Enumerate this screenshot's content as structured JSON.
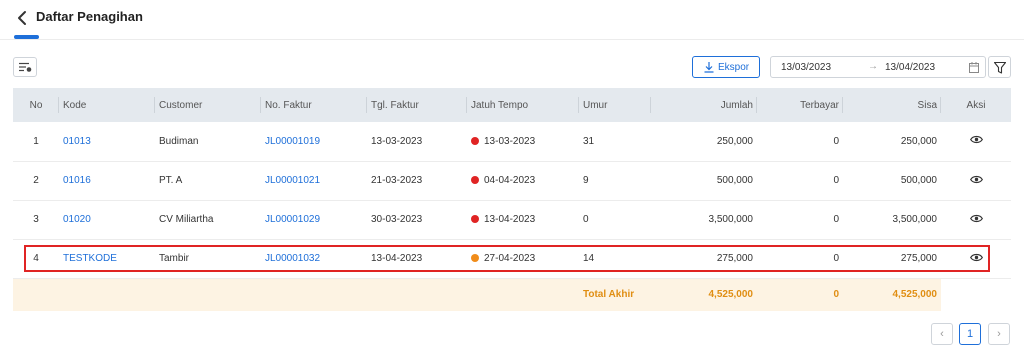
{
  "header": {
    "title": "Daftar Penagihan"
  },
  "toolbar": {
    "export_label": "Ekspor",
    "date_from": "13/03/2023",
    "date_arrow": "→",
    "date_to": "13/04/2023"
  },
  "table": {
    "columns": [
      "No",
      "Kode",
      "Customer",
      "No. Faktur",
      "Tgl. Faktur",
      "Jatuh Tempo",
      "Umur",
      "Jumlah",
      "Terbayar",
      "Sisa",
      "Aksi"
    ],
    "rows": [
      {
        "no": "1",
        "kode": "01013",
        "customer": "Budiman",
        "faktur": "JL00001019",
        "tgl": "13-03-2023",
        "jatuh_tempo": "13-03-2023",
        "status_color": "#e02424",
        "umur": "31",
        "jumlah": "250,000",
        "terbayar": "0",
        "sisa": "250,000"
      },
      {
        "no": "2",
        "kode": "01016",
        "customer": "PT. A",
        "faktur": "JL00001021",
        "tgl": "21-03-2023",
        "jatuh_tempo": "04-04-2023",
        "status_color": "#e02424",
        "umur": "9",
        "jumlah": "500,000",
        "terbayar": "0",
        "sisa": "500,000"
      },
      {
        "no": "3",
        "kode": "01020",
        "customer": "CV Miliartha",
        "faktur": "JL00001029",
        "tgl": "30-03-2023",
        "jatuh_tempo": "13-04-2023",
        "status_color": "#e02424",
        "umur": "0",
        "jumlah": "3,500,000",
        "terbayar": "0",
        "sisa": "3,500,000"
      },
      {
        "no": "4",
        "kode": "TESTKODE",
        "customer": "Tambir",
        "faktur": "JL00001032",
        "tgl": "13-04-2023",
        "jatuh_tempo": "27-04-2023",
        "status_color": "#f08c1a",
        "umur": "14",
        "jumlah": "275,000",
        "terbayar": "0",
        "sisa": "275,000"
      }
    ],
    "total": {
      "label": "Total Akhir",
      "jumlah": "4,525,000",
      "terbayar": "0",
      "sisa": "4,525,000"
    }
  },
  "pagination": {
    "prev": "‹",
    "current": "1",
    "next": "›"
  },
  "colors": {
    "accent": "#1e6fd9",
    "overdue": "#e02424",
    "due_soon": "#f08c1a",
    "total_bg": "#fdf3e3",
    "total_text": "#e08e13",
    "highlight": "#e02424"
  },
  "icons": {
    "back": "chevron-left-icon",
    "columns": "column-settings-icon",
    "export": "download-icon",
    "calendar": "calendar-icon",
    "filter": "filter-icon",
    "view": "eye-icon"
  }
}
